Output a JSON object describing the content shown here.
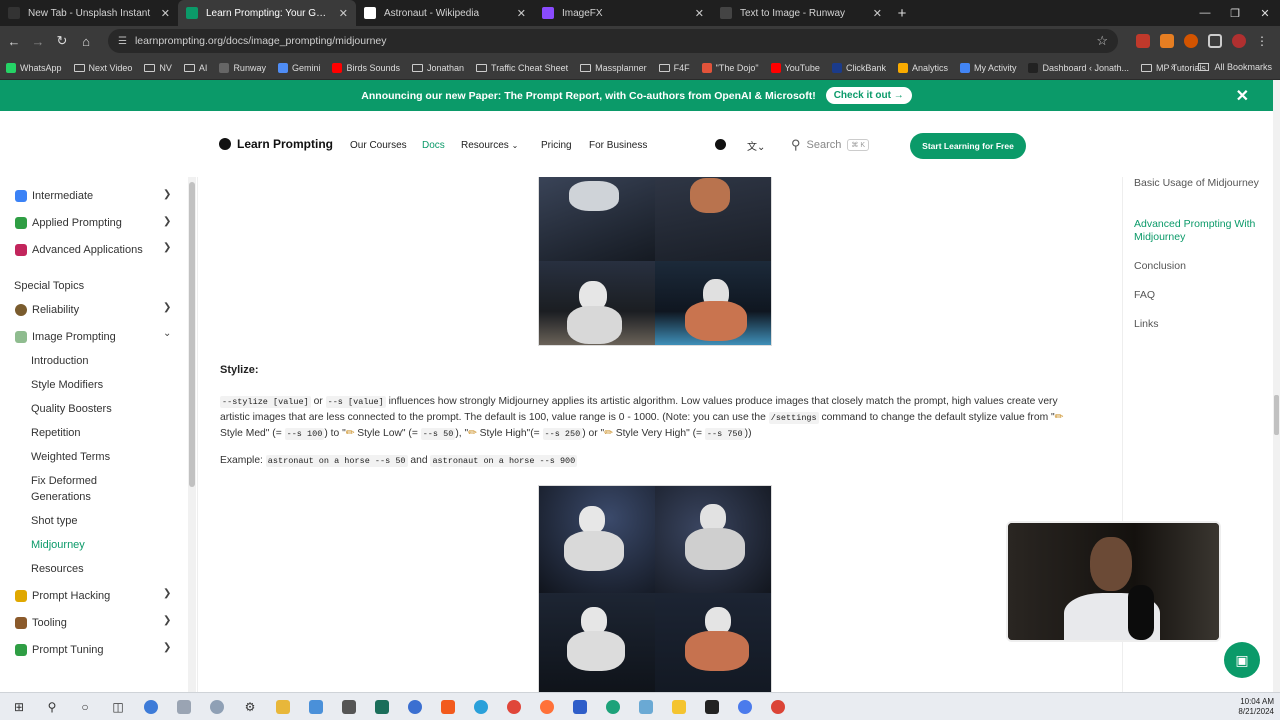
{
  "browser": {
    "tabs": [
      {
        "title": "New Tab - Unsplash Instant",
        "icon": "unsplash-icon",
        "color": "#333333",
        "active": false
      },
      {
        "title": "Learn Prompting: Your Guide to",
        "icon": "learnprompting-icon",
        "color": "#0b9a69",
        "active": true
      },
      {
        "title": "Astronaut - Wikipedia",
        "icon": "wikipedia-icon",
        "color": "#ffffff",
        "active": false
      },
      {
        "title": "ImageFX",
        "icon": "imagefx-icon",
        "color": "#8a4bff",
        "active": false
      },
      {
        "title": "Text to Image - Runway",
        "icon": "runway-icon",
        "color": "#444444",
        "active": false
      }
    ],
    "url": "learnprompting.org/docs/image_prompting/midjourney",
    "bookmarks": [
      {
        "label": "WhatsApp",
        "icon": "whatsapp-icon",
        "color": "#25d366"
      },
      {
        "label": "Next Video",
        "icon": "folder-icon"
      },
      {
        "label": "NV",
        "icon": "folder-icon"
      },
      {
        "label": "AI",
        "icon": "folder-icon"
      },
      {
        "label": "Runway",
        "icon": "runway-icon",
        "color": "#666666"
      },
      {
        "label": "Gemini",
        "icon": "gemini-icon",
        "color": "#4f8df5"
      },
      {
        "label": "Birds Sounds",
        "icon": "youtube-icon",
        "color": "#ff0000"
      },
      {
        "label": "Jonathan",
        "icon": "folder-icon"
      },
      {
        "label": "Traffic Cheat Sheet",
        "icon": "folder-icon"
      },
      {
        "label": "Massplanner",
        "icon": "folder-icon"
      },
      {
        "label": "F4F",
        "icon": "folder-icon"
      },
      {
        "label": "\"The Dojo\"",
        "icon": "dojo-icon",
        "color": "#e2533a"
      },
      {
        "label": "YouTube",
        "icon": "youtube-icon",
        "color": "#ff0000"
      },
      {
        "label": "ClickBank",
        "icon": "clickbank-icon",
        "color": "#1b3b8a"
      },
      {
        "label": "Analytics",
        "icon": "analytics-icon",
        "color": "#f9ab00"
      },
      {
        "label": "My Activity",
        "icon": "google-icon",
        "color": "#4285f4"
      },
      {
        "label": "Dashboard ‹ Jonath...",
        "icon": "wordpress-icon",
        "color": "#222222"
      },
      {
        "label": "MP Tutorials",
        "icon": "folder-icon"
      }
    ],
    "all_bookmarks": "All Bookmarks"
  },
  "announcement": {
    "text": "Announcing our new Paper: The Prompt Report, with Co-authors from OpenAI & Microsoft!",
    "cta": "Check it out →"
  },
  "header": {
    "logo_text": "Learn Prompting",
    "nav": [
      "Our Courses",
      "Docs",
      "Resources",
      "Pricing",
      "For Business"
    ],
    "search_placeholder": "Search",
    "search_kbd": "⌘ K",
    "cta": "Start Learning for Free",
    "accent": "#0b9a69"
  },
  "sidebar": {
    "top_items": [
      {
        "label": "Intermediate",
        "icon": "graduation-icon",
        "color": "#3b82f6"
      },
      {
        "label": "Applied Prompting",
        "icon": "pencil-icon",
        "color": "#2f9e44"
      },
      {
        "label": "Advanced Applications",
        "icon": "rocket-icon",
        "color": "#c2255c"
      }
    ],
    "section_label": "Special Topics",
    "mid_items": [
      {
        "label": "Reliability",
        "icon": "scale-icon",
        "color": "#7a5c2e"
      },
      {
        "label": "Image Prompting",
        "icon": "image-icon",
        "color": "#8fbc8f"
      }
    ],
    "sub_items": [
      "Introduction",
      "Style Modifiers",
      "Quality Boosters",
      "Repetition",
      "Weighted Terms",
      "Fix Deformed Generations",
      "Shot type",
      "Midjourney",
      "Resources"
    ],
    "active_sub": "Midjourney",
    "bottom_items": [
      {
        "label": "Prompt Hacking",
        "icon": "lock-icon",
        "color": "#e0a800"
      },
      {
        "label": "Tooling",
        "icon": "hammer-icon",
        "color": "#8b5a2b"
      },
      {
        "label": "Prompt Tuning",
        "icon": "pencil-icon",
        "color": "#2f9e44"
      }
    ]
  },
  "content": {
    "stylize_heading": "Stylize:",
    "paragraph": {
      "code1": "--stylize [value]",
      "t1": " or ",
      "code2": "--s [value]",
      "t2": " influences how strongly Midjourney applies its artistic algorithm. Low values produce images that closely match the prompt, high values create very artistic images that are less connected to the prompt. The default is 100, value range is 0 - 1000. (Note: you can use the ",
      "code3": "/settings",
      "t3": " command to change the default stylize value from \"",
      "t4": " Style Med\" (= ",
      "code4": "--s 100",
      "t5": ") to \"",
      "t6": " Style Low\" (= ",
      "code5": "--s 50",
      "t7": "), \"",
      "t8": " Style High\"(= ",
      "code6": "--s 250",
      "t9": ") or \"",
      "t10": " Style Very High\" (= ",
      "code7": "--s 750",
      "t11": "))"
    },
    "example": {
      "label": "Example: ",
      "code1": "astronaut on a horse --s 50",
      "and": " and ",
      "code2": "astronaut on a horse --s 900"
    }
  },
  "toc": {
    "items": [
      "Basic Usage of Midjourney",
      "Advanced Prompting With Midjourney",
      "Conclusion",
      "FAQ",
      "Links"
    ],
    "active": "Advanced Prompting With Midjourney"
  },
  "taskbar": {
    "time": "10:04 AM",
    "date": "8/21/2024"
  }
}
